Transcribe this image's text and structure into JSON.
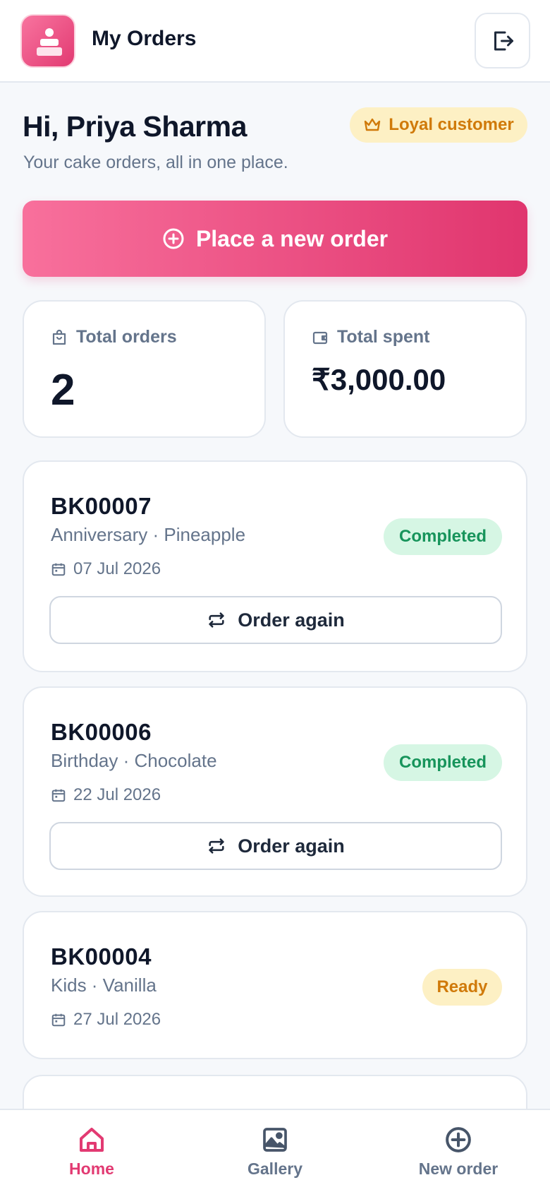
{
  "header": {
    "title": "My Orders"
  },
  "greeting": {
    "title": "Hi, Priya Sharma",
    "subtitle": "Your cake orders, all in one place.",
    "badge": "Loyal customer"
  },
  "cta": {
    "label": "Place a new order"
  },
  "stats": {
    "orders_label": "Total orders",
    "orders_value": "2",
    "spent_label": "Total spent",
    "spent_value": "₹3,000.00"
  },
  "orders": [
    {
      "id": "BK00007",
      "meta": "Anniversary · Pineapple",
      "date": "07 Jul 2026",
      "status": "Completed",
      "action": "Order again"
    },
    {
      "id": "BK00006",
      "meta": "Birthday · Chocolate",
      "date": "22 Jul 2026",
      "status": "Completed",
      "action": "Order again"
    },
    {
      "id": "BK00004",
      "meta": "Kids · Vanilla",
      "date": "27 Jul 2026",
      "status": "Ready"
    }
  ],
  "nav": {
    "items": [
      {
        "label": "Home",
        "icon": "home-icon"
      },
      {
        "label": "Gallery",
        "icon": "image-icon"
      },
      {
        "label": "New order",
        "icon": "plus-circle-icon"
      }
    ],
    "active": "Home"
  },
  "colors": {
    "accent": "#e23a72",
    "accent_light": "#f8709c",
    "completed_bg": "#d6f6e4",
    "completed_text": "#17945b",
    "ready_bg": "#fdf0c4",
    "ready_text": "#d07a0a"
  }
}
